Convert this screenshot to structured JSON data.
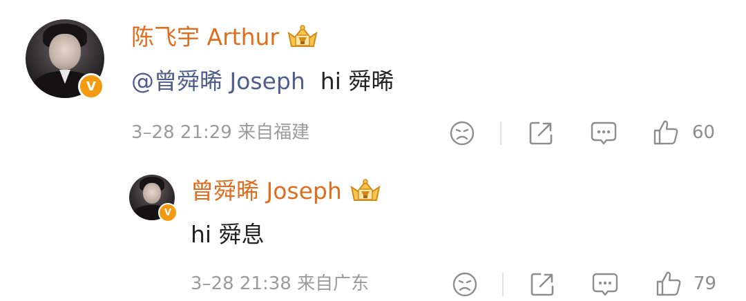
{
  "comment": {
    "author": "陈飞宇 Arthur",
    "mention": "@曾舜晞 Joseph",
    "text": "hi 舜晞",
    "date": "3–28",
    "time": "21:29",
    "location": "来自福建",
    "likes": "60"
  },
  "reply": {
    "author": "曾舜晞 Joseph",
    "text": "hi 舜息",
    "date": "3–28",
    "time": "21:38",
    "location": "来自广东",
    "likes": "79"
  },
  "verified_mark": "V",
  "icons": {
    "dislike": "sad-face-icon",
    "share": "share-icon",
    "comment": "comment-icon",
    "like": "thumbs-up-icon",
    "badge": "crown-badge-icon"
  },
  "colors": {
    "name": "#e06d1d",
    "mention": "#4e5d8b",
    "meta": "#9b9b9b",
    "verified": "#f39a10"
  }
}
